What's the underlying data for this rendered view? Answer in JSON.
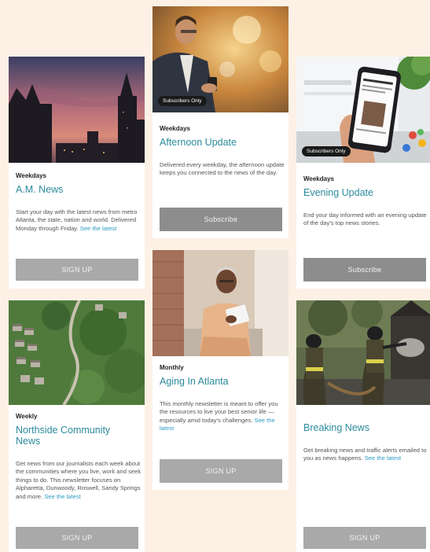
{
  "cards": {
    "am_news": {
      "frequency": "Weekdays",
      "title": "A.M. News",
      "description": "Start your day with the latest news from metro Atlanta, the state, nation and world. Delivered Monday through Friday.",
      "link": "See the latest",
      "button": "SIGN UP"
    },
    "afternoon": {
      "badge": "Subscribers Only",
      "frequency": "Weekdays",
      "title": "Afternoon Update",
      "description": "Delivered every weekday, the afternoon update keeps you connected to the news of the day.",
      "button": "Subscribe"
    },
    "evening": {
      "badge": "Subscribers Only",
      "frequency": "Weekdays",
      "title": "Evening Update",
      "description": "End your day informed with an evening update of the day's top news stories.",
      "button": "Subscribe"
    },
    "northside": {
      "frequency": "Weekly",
      "title_line1": "Northside Community",
      "title_line2": "News",
      "description": "Get news from our journalists each week about the communities where you live, work and seek things to do. This newsletter focuses on Alpharetta, Dunwoody, Roswell, Sandy Springs and more.",
      "link": "See the latest",
      "button": "SIGN UP"
    },
    "aging": {
      "frequency": "Monthly",
      "title": "Aging In Atlanta",
      "description": "This monthly newsletter is meant to offer you the resources to live your best senior life — especially amid today's challenges.",
      "link": "See the latest",
      "button": "SIGN UP"
    },
    "breaking": {
      "title": "Breaking News",
      "description": "Get breaking news and traffic alerts emailed to you as news happens.",
      "link": "See the latest",
      "button": "SIGN UP"
    }
  },
  "colors": {
    "background": "#fdf1e6",
    "title": "#2b8a9c",
    "link": "#2e9bc2",
    "button": "#a9a9a9"
  }
}
